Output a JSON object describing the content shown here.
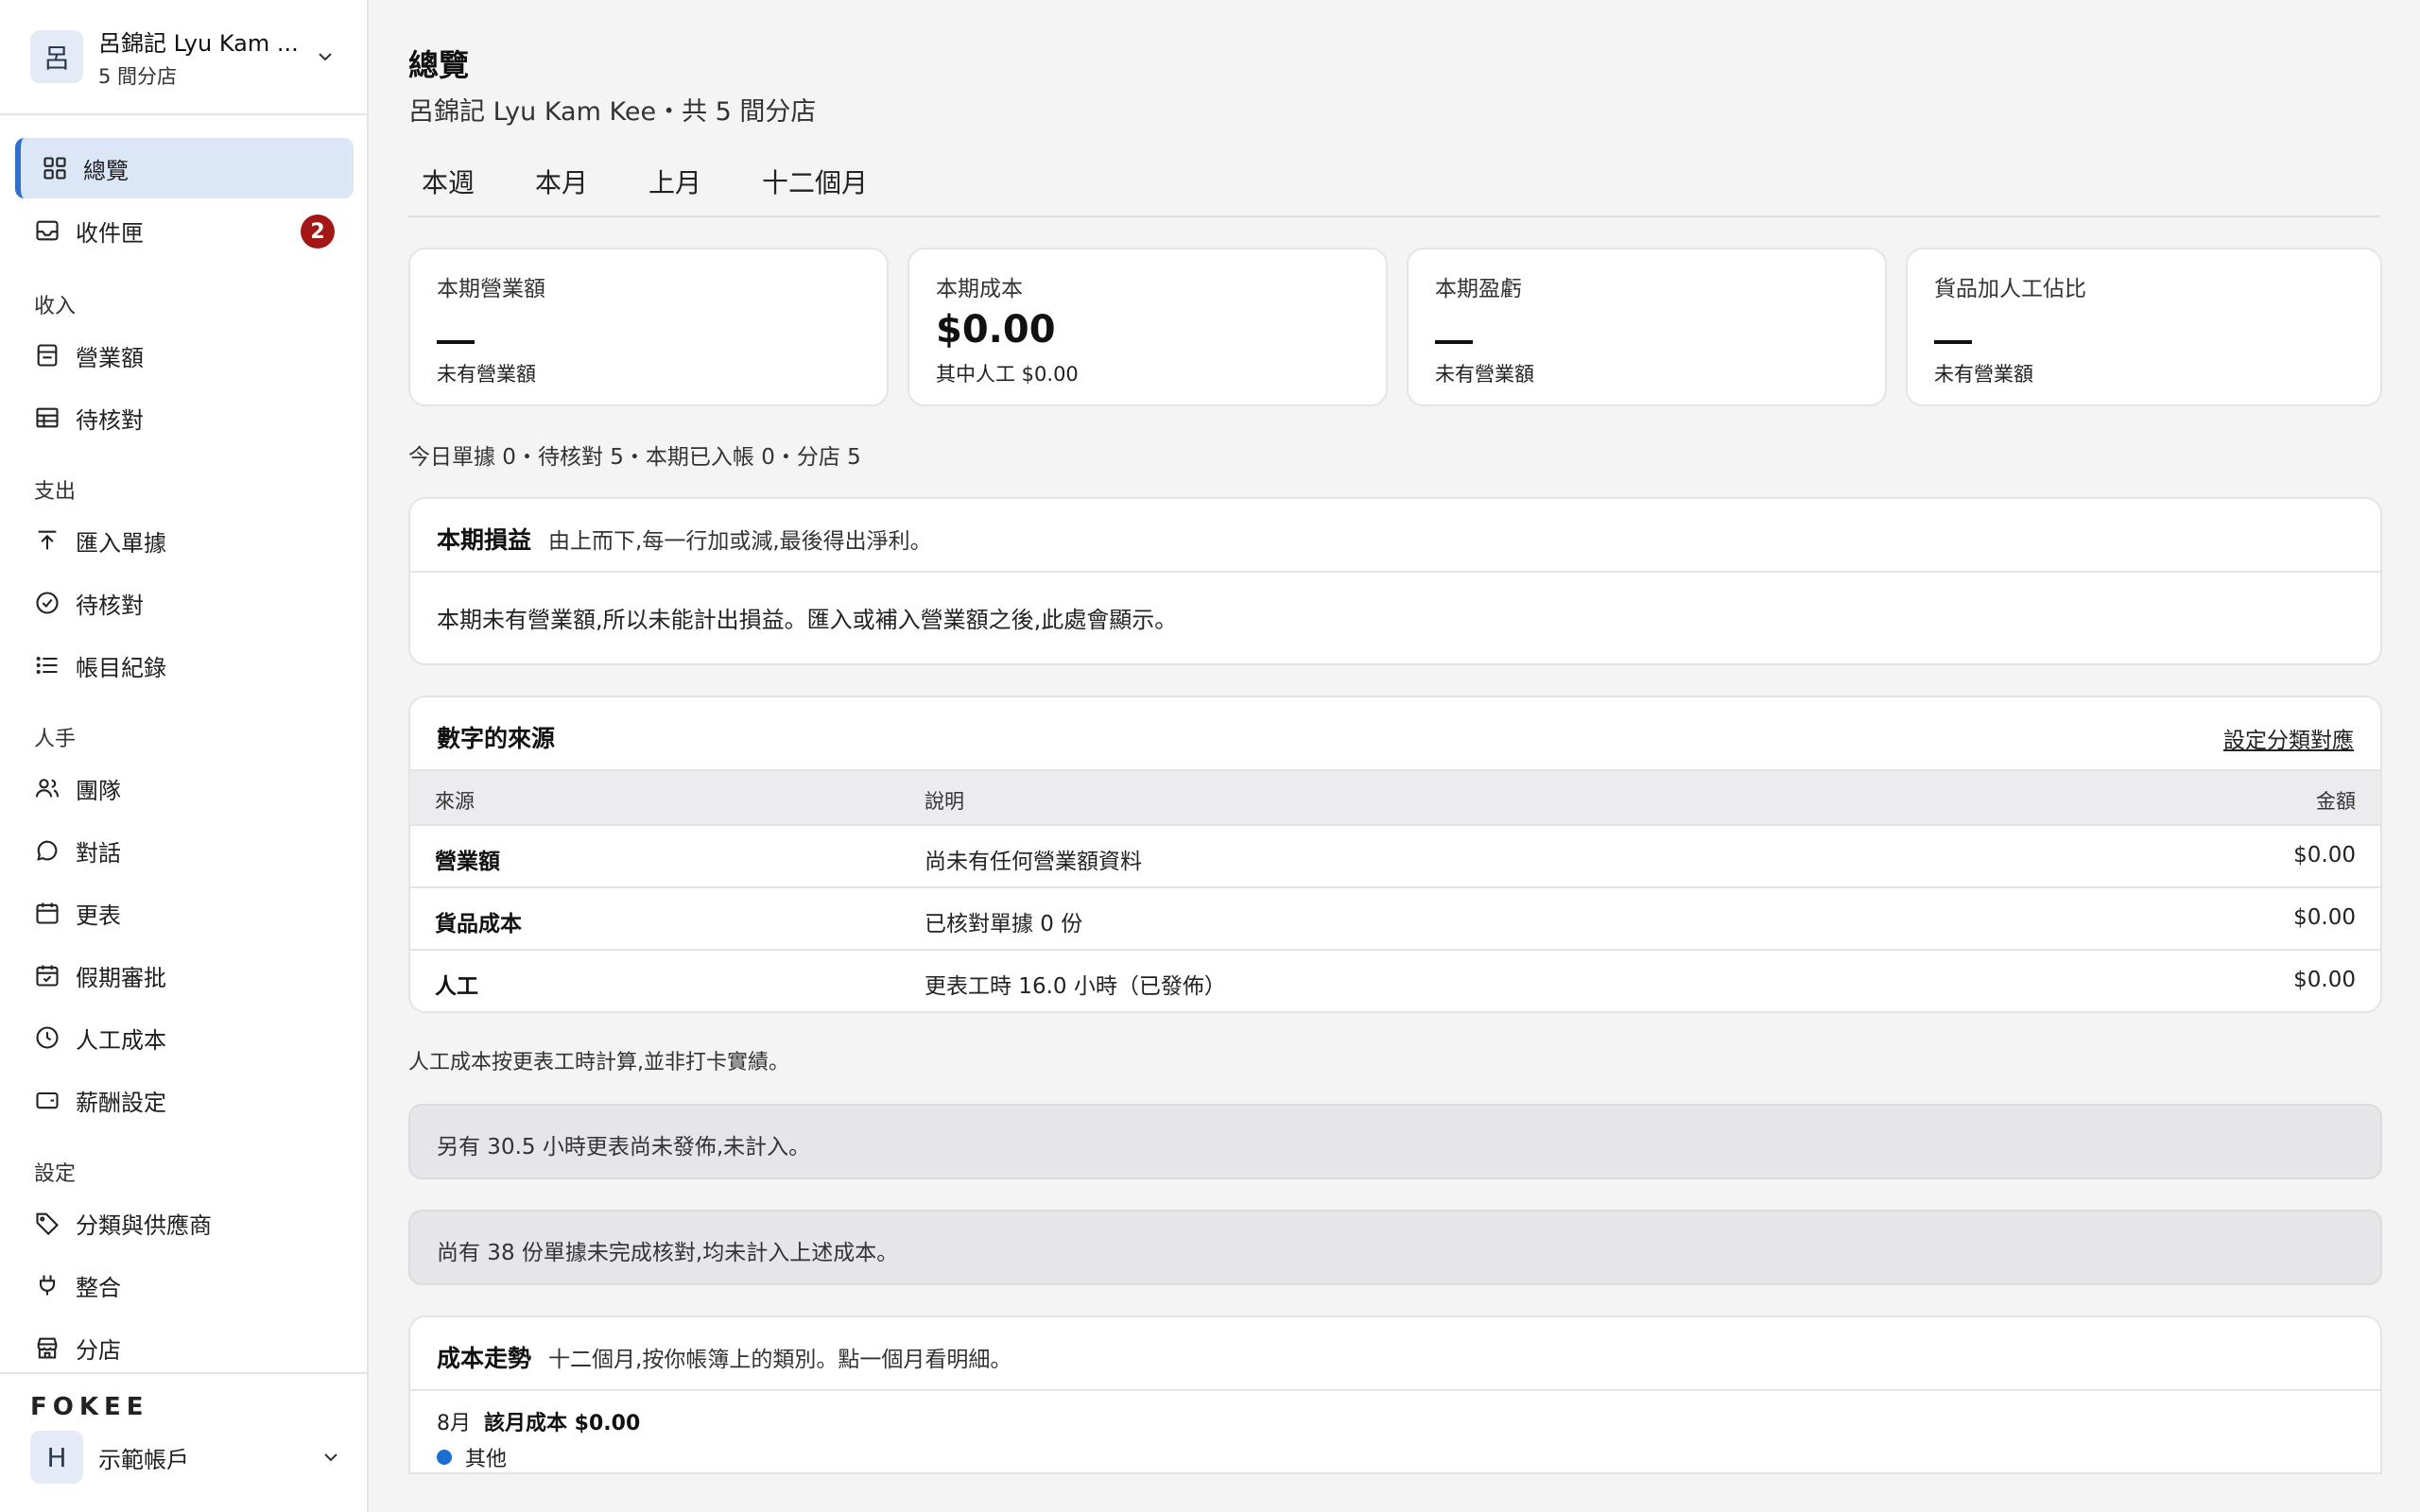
{
  "sidebar": {
    "org": {
      "avatar": "呂",
      "name": "呂錦記 Lyu Kam ...",
      "sub": "5 間分店"
    },
    "items": {
      "overview": "總覽",
      "inbox": "收件匣",
      "inbox_badge": "2",
      "income_header": "收入",
      "sales": "營業額",
      "income_pending": "待核對",
      "expense_header": "支出",
      "import_docs": "匯入單據",
      "expense_pending": "待核對",
      "ledger": "帳目紀錄",
      "staff_header": "人手",
      "team": "團隊",
      "chat": "對話",
      "roster": "更表",
      "leave": "假期審批",
      "labor_cost": "人工成本",
      "payroll": "薪酬設定",
      "settings_header": "設定",
      "categories": "分類與供應商",
      "integrations": "整合",
      "branches": "分店"
    },
    "brand": "FOKEE",
    "account": {
      "avatar": "H",
      "name": "示範帳戶"
    }
  },
  "main": {
    "title": "總覽",
    "subtitle": "呂錦記 Lyu Kam Kee・共 5 間分店",
    "tabs": [
      "本週",
      "本月",
      "上月",
      "十二個月"
    ],
    "kpis": [
      {
        "label": "本期營業額",
        "value": "—",
        "note": "未有營業額"
      },
      {
        "label": "本期成本",
        "value": "$0.00",
        "note": "其中人工 $0.00"
      },
      {
        "label": "本期盈虧",
        "value": "—",
        "note": "未有營業額"
      },
      {
        "label": "貨品加人工佔比",
        "value": "—",
        "note": "未有營業額"
      }
    ],
    "meta": "今日單據 0・待核對 5・本期已入帳 0・分店 5",
    "pnl": {
      "title": "本期損益",
      "desc": "由上而下,每一行加或減,最後得出淨利。",
      "body": "本期未有營業額,所以未能計出損益。匯入或補入營業額之後,此處會顯示。"
    },
    "sources": {
      "title": "數字的來源",
      "link": "設定分類對應",
      "headers": {
        "source": "來源",
        "desc": "說明",
        "amount": "金額"
      },
      "rows": [
        {
          "source": "營業額",
          "desc": "尚未有任何營業額資料",
          "amount": "$0.00"
        },
        {
          "source": "貨品成本",
          "desc": "已核對單據 0 份",
          "amount": "$0.00"
        },
        {
          "source": "人工",
          "desc": "更表工時 16.0 小時（已發佈）",
          "amount": "$0.00"
        }
      ]
    },
    "labor_note": "人工成本按更表工時計算,並非打卡實績。",
    "callout1": "另有 30.5 小時更表尚未發佈,未計入。",
    "callout2": "尚有 38 份單據未完成核對,均未計入上述成本。",
    "trend": {
      "title": "成本走勢",
      "desc": "十二個月,按你帳簿上的類別。點一個月看明細。",
      "month": "8月",
      "month_total": "該月成本 $0.00",
      "legend": "其他",
      "legend_color": "#1a6fd1"
    }
  }
}
